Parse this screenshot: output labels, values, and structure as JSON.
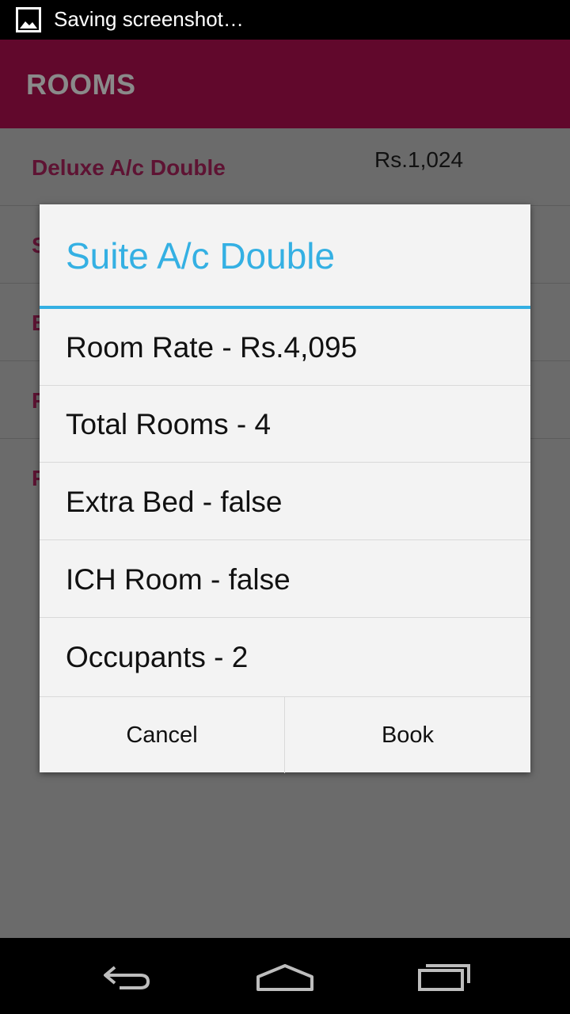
{
  "status_bar": {
    "notification_text": "Saving screenshot…",
    "notification_icon": "image-icon"
  },
  "action_bar": {
    "title": "ROOMS"
  },
  "room_list": {
    "items": [
      {
        "label": "Deluxe A/c Double",
        "price": "Rs.1,024"
      },
      {
        "label": "S",
        "price": ""
      },
      {
        "label": "B",
        "price": ""
      },
      {
        "label": "P",
        "price": ""
      },
      {
        "label": "P",
        "price": ""
      }
    ]
  },
  "dialog": {
    "title": "Suite A/c Double",
    "items": [
      {
        "text": "Room Rate - Rs.4,095"
      },
      {
        "text": "Total Rooms - 4"
      },
      {
        "text": "Extra Bed - false"
      },
      {
        "text": "ICH Room - false"
      },
      {
        "text": "Occupants - 2"
      }
    ],
    "cancel_label": "Cancel",
    "book_label": "Book"
  },
  "nav_bar": {
    "back_icon": "back-icon",
    "home_icon": "home-icon",
    "recents_icon": "recents-icon"
  },
  "colors": {
    "accent": "#34b0e3",
    "action_bar": "#61082c",
    "row_label": "#5e1333"
  }
}
